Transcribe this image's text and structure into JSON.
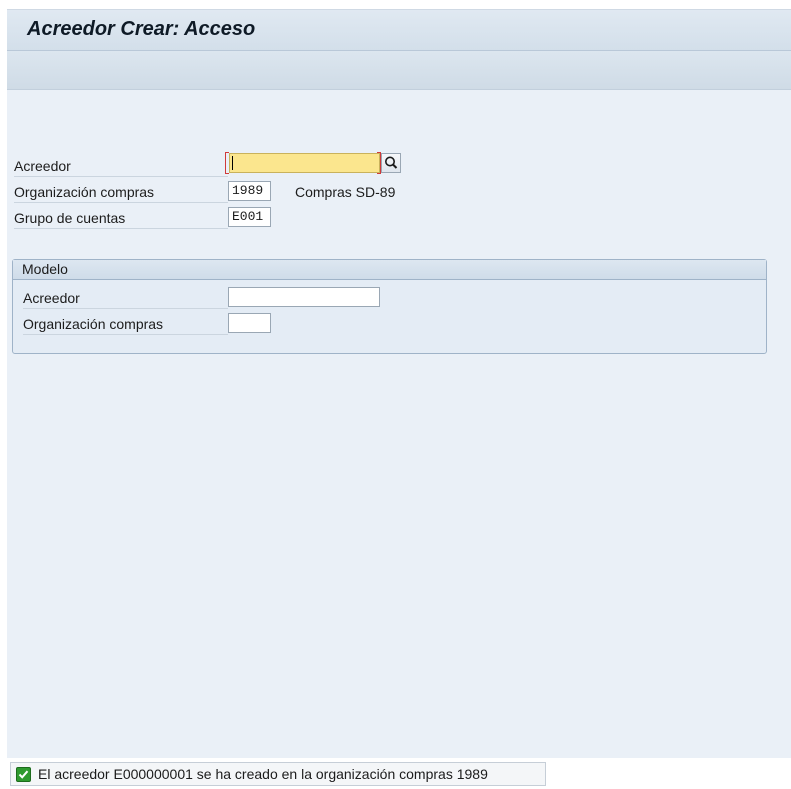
{
  "screen": {
    "title": "Acreedor Crear: Acceso"
  },
  "fields": {
    "acreedor": {
      "label": "Acreedor",
      "value": ""
    },
    "org_compras": {
      "label": "Organización compras",
      "value": "1989",
      "description": "Compras SD-89"
    },
    "grupo_cuentas": {
      "label": "Grupo de cuentas",
      "value": "E001"
    }
  },
  "modelo": {
    "title": "Modelo",
    "acreedor": {
      "label": "Acreedor",
      "value": ""
    },
    "org_compras": {
      "label": "Organización compras",
      "value": ""
    }
  },
  "status": {
    "type": "success",
    "icon": "checkmark-icon",
    "message": "El acreedor E000000001 se ha creado en la organización compras 1989"
  },
  "colors": {
    "background": "#eaf0f7",
    "required_field": "#fbe68e",
    "success": "#2f9a2f"
  }
}
